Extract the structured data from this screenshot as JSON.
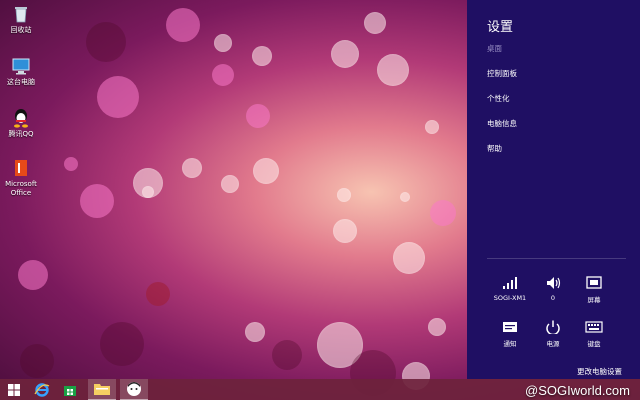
{
  "desktop": {
    "icons": [
      {
        "label": "回收站",
        "icon": "recycle-bin-icon"
      },
      {
        "label": "这台电脑",
        "icon": "this-pc-icon"
      },
      {
        "label": "腾讯QQ",
        "icon": "qq-icon"
      },
      {
        "label": "Microsoft Office",
        "icon": "office-icon"
      }
    ]
  },
  "settings_panel": {
    "title": "设置",
    "context": "桌面",
    "links": [
      "控制面板",
      "个性化",
      "电脑信息",
      "帮助"
    ],
    "quick_tiles": [
      {
        "label": "SOGI-XM1",
        "icon": "wifi-signal-icon"
      },
      {
        "label": "0",
        "icon": "volume-icon"
      },
      {
        "label": "屏幕",
        "icon": "screen-brightness-icon"
      },
      {
        "label": "通知",
        "icon": "notifications-icon"
      },
      {
        "label": "电源",
        "icon": "power-icon"
      },
      {
        "label": "键盘",
        "icon": "keyboard-icon"
      }
    ],
    "change_settings": "更改电脑设置"
  },
  "taskbar": {
    "buttons": [
      "start-icon",
      "internet-explorer-icon",
      "store-icon",
      "file-explorer-icon",
      "app-avatar-icon"
    ]
  },
  "watermark": "@SOGIworld.com",
  "colors": {
    "panel_bg": "#1f0f63",
    "taskbar_bg": "#6e233c"
  }
}
